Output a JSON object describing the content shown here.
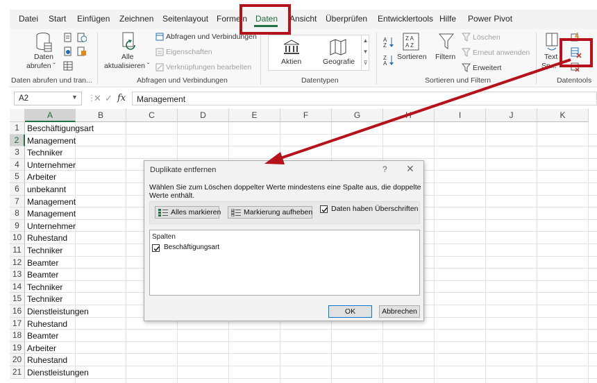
{
  "menu": {
    "tabs": [
      {
        "label": "Datei",
        "active": false
      },
      {
        "label": "Start",
        "active": false
      },
      {
        "label": "Einfügen",
        "active": false
      },
      {
        "label": "Zeichnen",
        "active": false
      },
      {
        "label": "Seitenlayout",
        "active": false
      },
      {
        "label": "Formeln",
        "active": false
      },
      {
        "label": "Daten",
        "active": true
      },
      {
        "label": "Ansicht",
        "active": false
      },
      {
        "label": "Überprüfen",
        "active": false
      },
      {
        "label": "Entwicklertools",
        "active": false
      },
      {
        "label": "Hilfe",
        "active": false
      },
      {
        "label": "Power Pivot",
        "active": false
      }
    ]
  },
  "ribbon": {
    "group1": {
      "name": "Daten abrufen und tran...",
      "get_data_l1": "Daten",
      "get_data_l2": "abrufen ˇ"
    },
    "group2": {
      "name": "Abfragen und Verbindungen",
      "refresh_l1": "Alle",
      "refresh_l2": "aktualisieren ˇ",
      "queries": "Abfragen und Verbindungen",
      "properties": "Eigenschaften",
      "links": "Verknüpfungen bearbeiten"
    },
    "group3": {
      "name": "Datentypen",
      "stocks": "Aktien",
      "geography": "Geografie"
    },
    "group4": {
      "name": "Sortieren und Filtern",
      "sort": "Sortieren",
      "filter": "Filtern",
      "clear": "Löschen",
      "reapply": "Erneut anwenden",
      "advanced": "Erweitert"
    },
    "group5": {
      "name": "Datentools",
      "text_l1": "Text",
      "text_l2": "Sp..."
    }
  },
  "formula_bar": {
    "name_box": "A2",
    "fx": "fx",
    "content": "Management"
  },
  "grid": {
    "columns": [
      "A",
      "B",
      "C",
      "D",
      "E",
      "F",
      "G",
      "H",
      "I",
      "J",
      "K"
    ],
    "selected_column": "A",
    "rows": [
      {
        "num": "1",
        "a": "Beschäftigungsart"
      },
      {
        "num": "2",
        "a": "Management"
      },
      {
        "num": "3",
        "a": "Techniker"
      },
      {
        "num": "4",
        "a": "Unternehmer"
      },
      {
        "num": "5",
        "a": "Arbeiter"
      },
      {
        "num": "6",
        "a": "unbekannt"
      },
      {
        "num": "7",
        "a": "Management"
      },
      {
        "num": "8",
        "a": "Management"
      },
      {
        "num": "9",
        "a": "Unternehmer"
      },
      {
        "num": "10",
        "a": "Ruhestand"
      },
      {
        "num": "11",
        "a": "Techniker"
      },
      {
        "num": "12",
        "a": "Beamter"
      },
      {
        "num": "13",
        "a": "Beamter"
      },
      {
        "num": "14",
        "a": "Techniker"
      },
      {
        "num": "15",
        "a": "Techniker"
      },
      {
        "num": "16",
        "a": "Dienstleistungen"
      },
      {
        "num": "17",
        "a": "Ruhestand"
      },
      {
        "num": "18",
        "a": "Beamter"
      },
      {
        "num": "19",
        "a": "Arbeiter"
      },
      {
        "num": "20",
        "a": "Ruhestand"
      },
      {
        "num": "21",
        "a": "Dienstleistungen"
      }
    ]
  },
  "dialog": {
    "title": "Duplikate entfernen",
    "help": "?",
    "close": "✕",
    "description": "Wählen Sie zum Löschen doppelter Werte mindestens eine Spalte aus, die doppelte Werte enthält.",
    "select_all": "Alles markieren",
    "unselect_all": "Markierung aufheben",
    "has_headers": "Daten haben Überschriften",
    "has_headers_checked": true,
    "list_header": "Spalten",
    "columns": [
      {
        "label": "Beschäftigungsart",
        "checked": true
      }
    ],
    "ok": "OK",
    "cancel": "Abbrechen"
  },
  "annotations": {
    "color": "#b5121b"
  }
}
